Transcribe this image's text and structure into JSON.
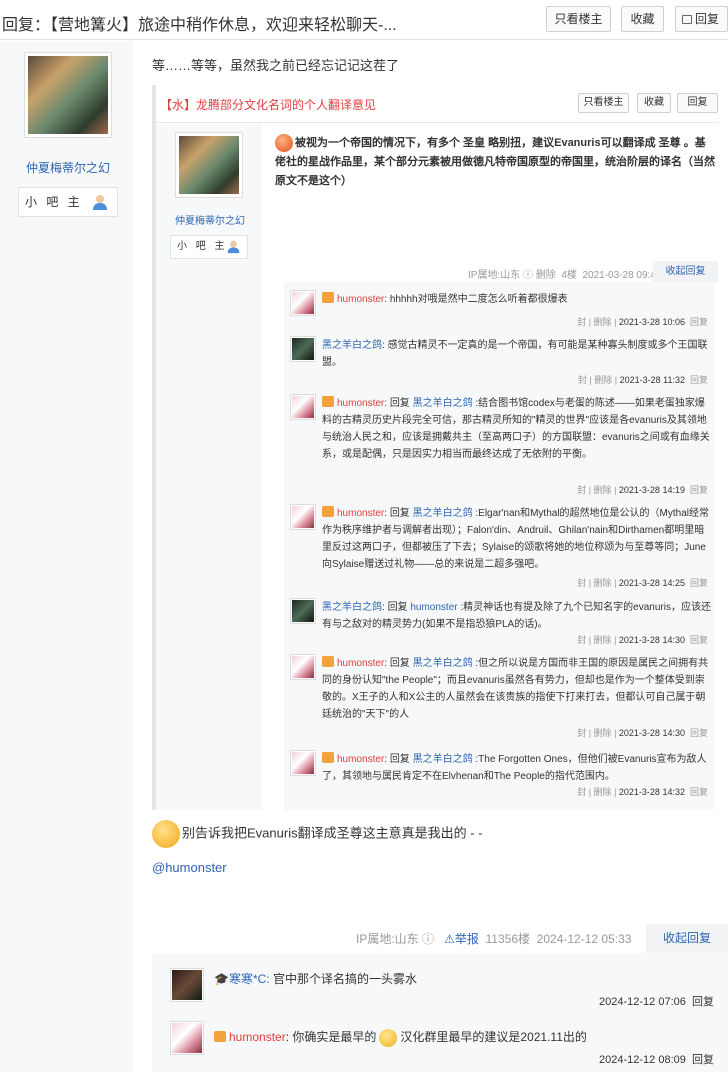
{
  "header": {
    "title": "回复：【营地篝火】旅途中稍作休息，欢迎来轻松聊天-...",
    "only_op": "只看楼主",
    "favorite": "收藏",
    "reply": "回复"
  },
  "author": {
    "name": "仲夏梅蒂尔之幻",
    "badge": "小 吧 主"
  },
  "post": {
    "text": "等……等等，虽然我之前已经忘记记这茬了",
    "footer_text": "别告诉我把Evanuris翻译成圣尊这主意真是我出的 - -",
    "mention": "@humonster"
  },
  "quote": {
    "title": "【水】龙腾部分文化名词的个人翻译意见",
    "only_op": "只看楼主",
    "favorite": "收藏",
    "reply": "回复",
    "author_name": "仲夏梅蒂尔之幻",
    "author_badge": "小 吧 主",
    "body": "被视为一个帝国的情况下，有多个 圣皇 略别扭，建议Evanuris可以翻译成 圣尊 。基佬社的星战作品里，某个部分元素被用做德凡特帝国原型的帝国里，统治阶层的译名（当然原文不是这个）",
    "meta": {
      "ip": "IP属地:山东",
      "delete": "删除",
      "floor": "4楼",
      "time": "2021-03-28 09:41",
      "collapse": "收起回复"
    },
    "replies": [
      {
        "user": "humonster",
        "text": "hhhhh对哦是然中二度怎么听着都很爆表",
        "meta": "2021-3-28 10:06"
      },
      {
        "user": "黑之羊白之鸽",
        "text": "感觉古精灵不一定真的是一个帝国，有可能是某种寡头制度或多个王国联盟。",
        "meta": "2021-3-28 11:32"
      },
      {
        "user": "humonster",
        "reply_to": "黑之羊白之鸽",
        "text": "结合图书馆codex与老蛋的陈述——如果老蛋独家爆料的古精灵历史片段完全可信，那古精灵所知的\"精灵的世界\"应该是各evanuris及其领地与统治人民之和，应该是拥戴共主（至高两口子）的方国联盟：evanuris之间或有血缘关系，或是配偶，只是因实力相当而最终达成了无依附的平衡。",
        "meta": "2021-3-28 14:19"
      },
      {
        "user": "humonster",
        "reply_to": "黑之羊白之鸽",
        "text": "Elgar'nan和Mythal的超然地位是公认的（Mythal经常作为秩序维护者与调解者出现）；Falon'din、Andruil、Ghilan'nain和Dirthamen都明里暗里反过这两口子，但都被压了下去；Sylaise的颂歌将她的地位称颂为与至尊等同；June向Sylaise赠送过礼物——总的来说是二超多强吧。",
        "meta": "2021-3-28 14:25"
      },
      {
        "user": "黑之羊白之鸽",
        "reply_to": "humonster",
        "text": "精灵神话也有提及除了九个已知名字的evanuris，应该还有与之敌对的精灵势力(如果不是指恐狼PLA的话)。",
        "meta": "2021-3-28 14:30"
      },
      {
        "user": "humonster",
        "reply_to": "黑之羊白之鸽",
        "text": "但之所以说是方国而非王国的原因是属民之间拥有共同的身份认知\"the People\"；而且evanuris虽然各有势力，但却也是作为一个整体受到崇敬的。X王子的人和X公主的人虽然会在该贵族的指使下打来打去，但都认可自己属于朝廷统治的\"天下\"的人",
        "meta": "2021-3-28 14:30"
      },
      {
        "user": "humonster",
        "reply_to": "黑之羊白之鸽",
        "text": "The Forgotten Ones，但他们被Evanuris宣布为敌人了，其领地与属民肯定不在Elvhenan和The People的指代范围内。",
        "meta": "2021-3-28 14:32"
      }
    ],
    "row_actions": {
      "report": "封",
      "delete": "删除",
      "reply": "回复",
      "reply_prefix": "回复"
    }
  },
  "meta": {
    "ip": "IP属地:山东",
    "report": "举报",
    "floor": "11356楼",
    "time": "2024-12-12 05:33",
    "collapse": "收起回复"
  },
  "comments": [
    {
      "user": "寒寒*C:",
      "text": "官中那个译名搞的一头雾水",
      "time": "2024-12-12 07:06",
      "reply": "回复"
    },
    {
      "user": "humonster",
      "text_a": "你确实是最早的",
      "text_b": "汉化群里最早的建议是2021.11出的",
      "time": "2024-12-12 08:09",
      "reply": "回复"
    }
  ],
  "colors": {
    "link": "#2d64b3",
    "red": "#e13c3c",
    "panel": "#f7f8fa"
  }
}
